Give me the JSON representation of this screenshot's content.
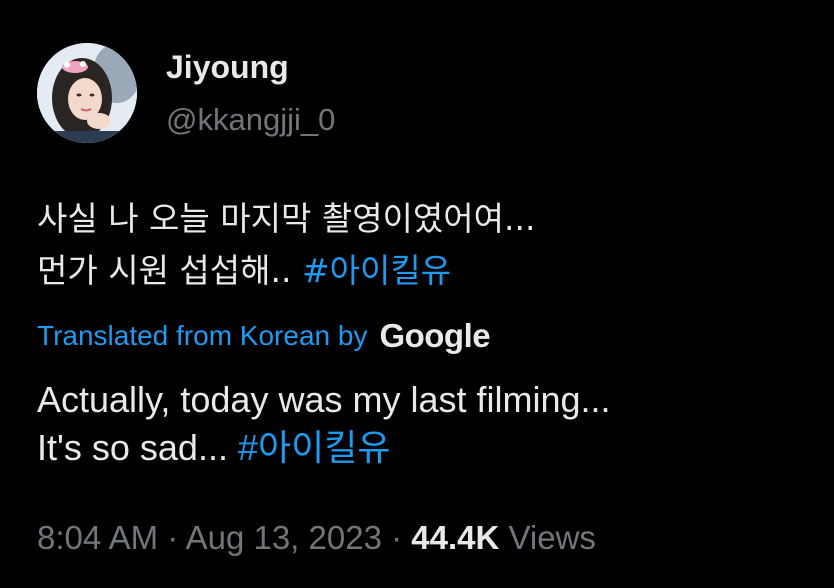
{
  "author": {
    "display_name": "Jiyoung",
    "handle": "@kkangjji_0"
  },
  "tweet": {
    "original_line_1": "사실 나 오늘 마지막 촬영이였어여...",
    "original_line_2_text": "먼가 시원 섭섭해.. ",
    "original_hashtag": "#아이킬유",
    "translation_label": "Translated from Korean by",
    "translation_provider": "Google",
    "translated_line_1": "Actually, today was my last filming...",
    "translated_line_2_text": "It's so sad... ",
    "translated_hashtag": "#아이킬유"
  },
  "meta": {
    "time": "8:04 AM",
    "separator_1": " · ",
    "date": "Aug 13, 2023",
    "separator_2": " · ",
    "views_count": "44.4K",
    "views_label": " Views"
  },
  "colors": {
    "background": "#000000",
    "primary_text": "#e7e9ea",
    "secondary_text": "#71767b",
    "accent": "#1d9bf0"
  },
  "icons": {
    "avatar": "profile-photo"
  }
}
